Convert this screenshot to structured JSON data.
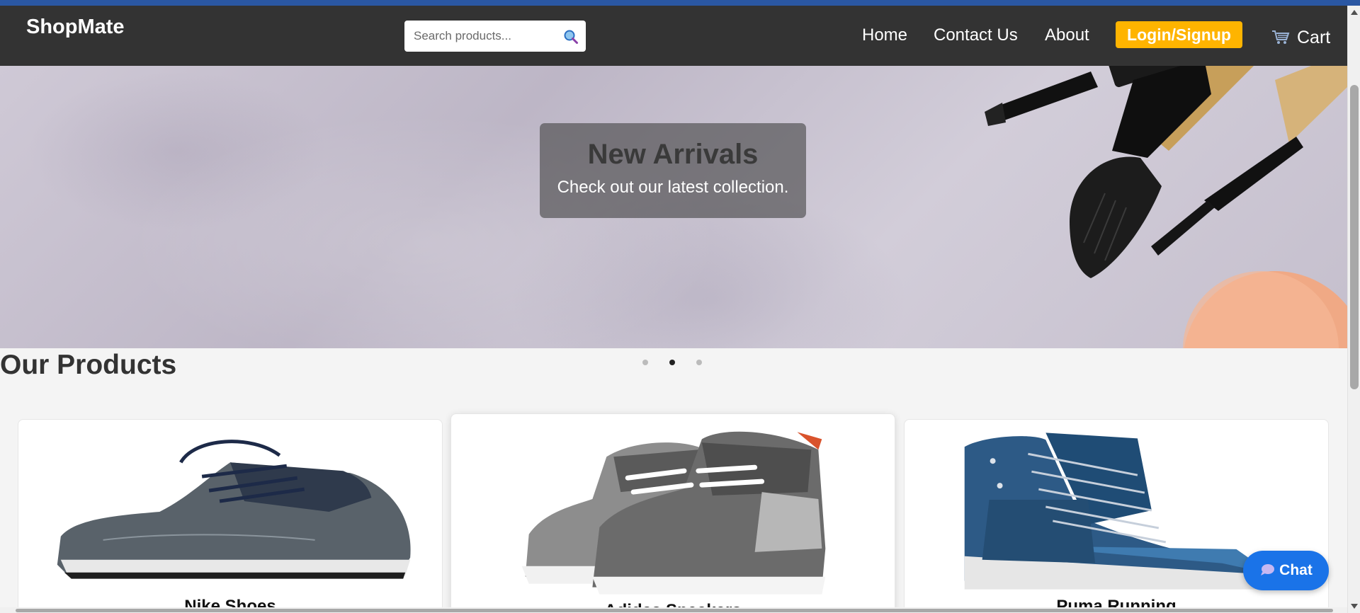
{
  "navbar": {
    "logo": "ShopMate",
    "search_placeholder": "Search products...",
    "links": [
      "Home",
      "Contact Us",
      "About"
    ],
    "login_label": "Login/Signup",
    "cart_label": "Cart"
  },
  "hero": {
    "title": "New Arrivals",
    "subtitle": "Check out our latest collection.",
    "active_slide": 2,
    "slide_count": 3
  },
  "products": {
    "section_title": "Our Products",
    "items": [
      {
        "name": "Nike Shoes"
      },
      {
        "name": "Adidas Sneakers"
      },
      {
        "name": "Puma Running"
      }
    ]
  },
  "chat": {
    "label": "Chat"
  },
  "colors": {
    "navbar_bg": "#333333",
    "accent": "#ffb400",
    "chat": "#1a73e8",
    "page_bg": "#f4f4f4"
  },
  "icons": [
    "search-icon",
    "cart-icon",
    "chat-bubble-icon"
  ]
}
